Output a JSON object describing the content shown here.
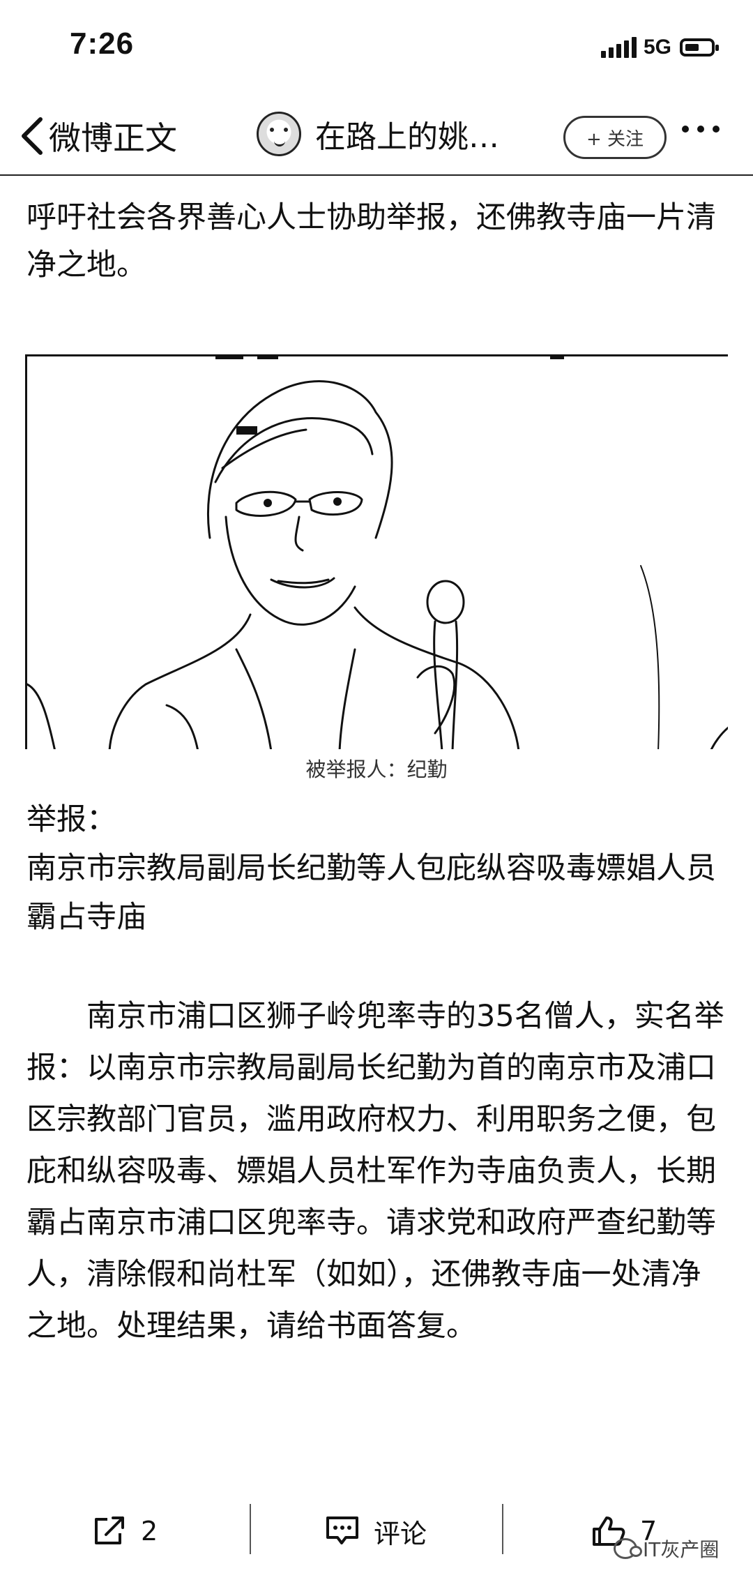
{
  "status_bar": {
    "time": "7:26",
    "network": "5G",
    "battery_level": 0.55
  },
  "nav": {
    "back_label": "微博正文",
    "username": "在路上的姚…",
    "follow_label": "+ 关注",
    "icons": [
      "chevron-left-icon",
      "avatar",
      "more-icon"
    ]
  },
  "post": {
    "intro_text": "呼吁社会各界善心人士协助举报，还佛教寺庙一片清净之地。",
    "photo_caption": "被举报人：纪勤",
    "report_label": "举报：",
    "report_title": "南京市宗教局副局长纪勤等人包庇纵容吸毒嫖娼人员霸占寺庙",
    "body": "南京市浦口区狮子岭兜率寺的35名僧人，实名举报：以南京市宗教局副局长纪勤为首的南京市及浦口区宗教部门官员，滥用政府权力、利用职务之便，包庇和纵容吸毒、嫖娼人员杜军作为寺庙负责人，长期霸占南京市浦口区兜率寺。请求党和政府严查纪勤等人，清除假和尚杜军（如如），还佛教寺庙一处清净之地。处理结果，请给书面答复。"
  },
  "toolbar": {
    "share_count": "2",
    "comment_label": "评论",
    "like_count": "7",
    "icons": [
      "share-icon",
      "comment-icon",
      "like-icon"
    ]
  },
  "watermark": {
    "text": "IT灰产圈"
  }
}
